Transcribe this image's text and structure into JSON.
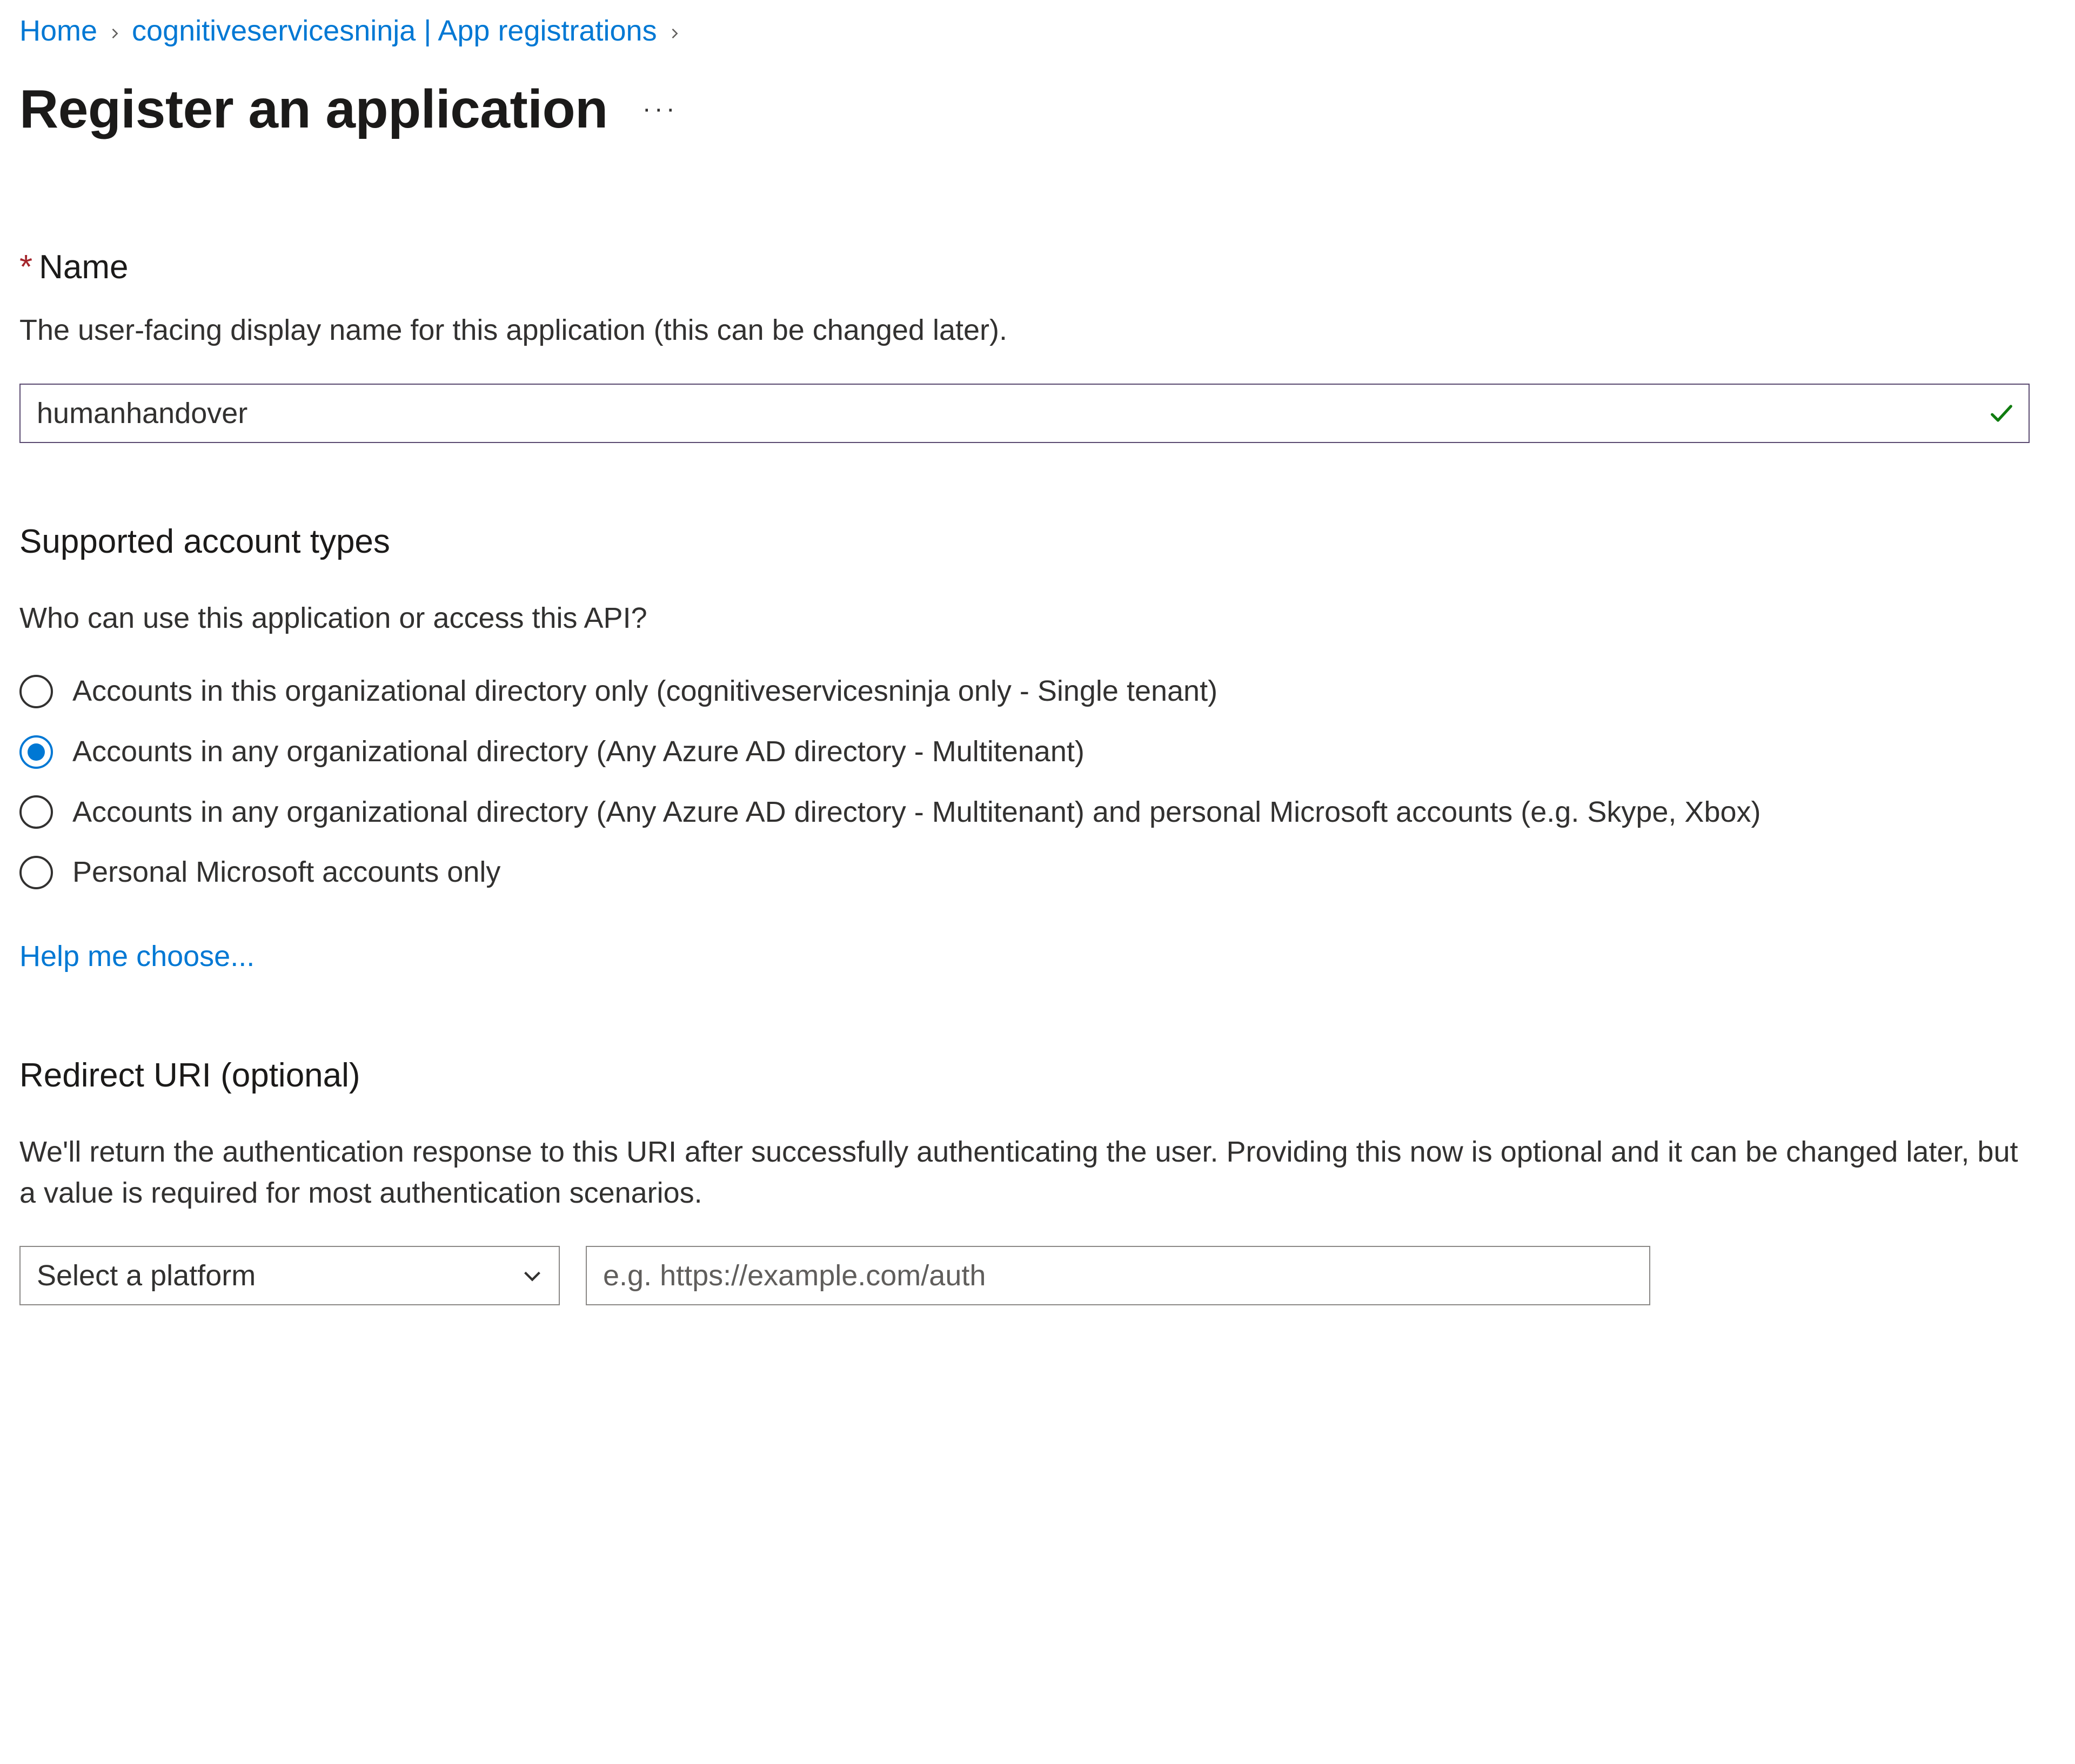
{
  "breadcrumb": {
    "items": [
      {
        "label": "Home"
      },
      {
        "label": "cognitiveservicesninja | App registrations"
      }
    ]
  },
  "header": {
    "title": "Register an application"
  },
  "name_section": {
    "label": "Name",
    "helper": "The user-facing display name for this application (this can be changed later).",
    "value": "humanhandover"
  },
  "account_types": {
    "heading": "Supported account types",
    "helper": "Who can use this application or access this API?",
    "options": [
      {
        "label": "Accounts in this organizational directory only (cognitiveservicesninja only - Single tenant)",
        "checked": false
      },
      {
        "label": "Accounts in any organizational directory (Any Azure AD directory - Multitenant)",
        "checked": true
      },
      {
        "label": "Accounts in any organizational directory (Any Azure AD directory - Multitenant) and personal Microsoft accounts (e.g. Skype, Xbox)",
        "checked": false
      },
      {
        "label": "Personal Microsoft accounts only",
        "checked": false
      }
    ],
    "help_link": "Help me choose..."
  },
  "redirect_uri": {
    "heading": "Redirect URI (optional)",
    "helper": "We'll return the authentication response to this URI after successfully authenticating the user. Providing this now is optional and it can be changed later, but a value is required for most authentication scenarios.",
    "platform_placeholder": "Select a platform",
    "uri_placeholder": "e.g. https://example.com/auth"
  }
}
